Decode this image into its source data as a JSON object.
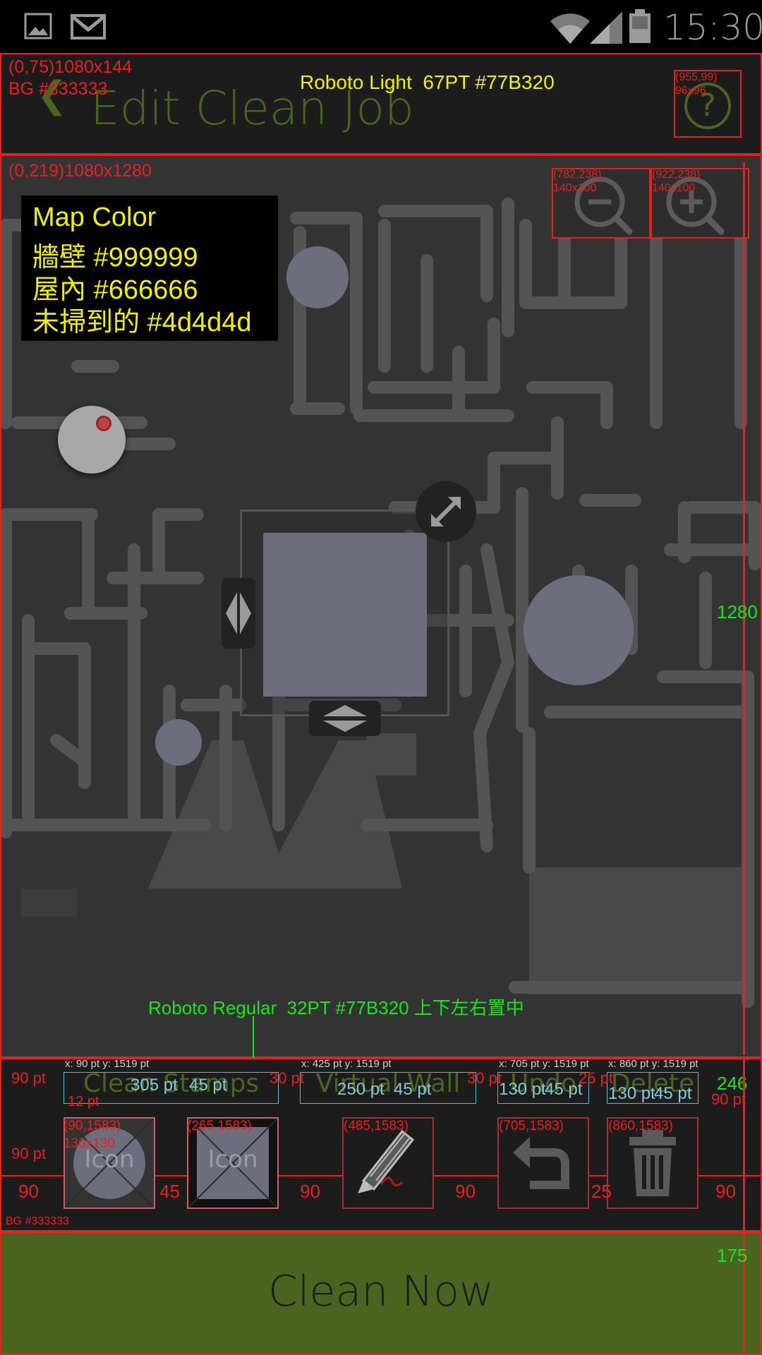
{
  "status_bar": {
    "time": "15:30"
  },
  "header": {
    "back_glyph": "❮",
    "title": "Edit Clean Job",
    "help_glyph": "?",
    "note_geom": "(0,75)1080x144",
    "note_bg": "BG #333333",
    "font_note": "Roboto Light  67PT #77B320",
    "help_note": "(955,99)\n96x96"
  },
  "map": {
    "note_geom": "(0,219)1080x1280",
    "zoom_out_note": "(782,238)\n140x100",
    "zoom_in_note": "(922,238)\n140x100",
    "height_label": "1280",
    "legend": {
      "title": "Map Color",
      "lines": [
        "牆壁 #999999",
        "屋內 #666666",
        "未掃到的 #4d4d4d"
      ]
    },
    "colors": {
      "wall": "#999999",
      "indoor": "#666666",
      "unswept": "#4d4d4d"
    },
    "font_note": "Roboto Regular  32PT #77B320 上下左右置中"
  },
  "toolbar": {
    "labels": [
      {
        "text": "Clean Stamps",
        "coord": "x: 90 pt y: 1519 pt",
        "w": "305 pt",
        "h": "45 pt"
      },
      {
        "text": "Virtual Wall",
        "coord": "x: 425 pt y: 1519 pt",
        "w": "250 pt",
        "h": "45 pt"
      },
      {
        "text": "Undo",
        "coord": "x: 705 pt y: 1519 pt",
        "w": "130 pt",
        "h": "45 pt"
      },
      {
        "text": "Delete",
        "coord": "x: 860 pt y: 1519 pt",
        "w": "130 pt",
        "h": "45 pt"
      }
    ],
    "buttons": [
      {
        "coord": "(90,1583)",
        "size": "130x130",
        "text": "Icon"
      },
      {
        "coord": "(265,1583)",
        "text": "Icon"
      },
      {
        "coord": "(485,1583)"
      },
      {
        "coord": "(705,1583)"
      },
      {
        "coord": "(860,1583)"
      }
    ],
    "annotations": {
      "left_pt": "90 pt",
      "gap1_pt": "30 pt",
      "gap2_pt": "30 pt",
      "gap3_pt": "25 pt",
      "right_pt": "90 pt",
      "top_pt": "12 pt",
      "icon_left_pt": "90 pt",
      "height_label": "246",
      "bg_note": "BG #333333",
      "dims": [
        "90",
        "45",
        "90",
        "90",
        "25",
        "90"
      ]
    }
  },
  "clean_now": {
    "label": "Clean Now",
    "height_label": "175"
  },
  "colors": {
    "accent": "#77B320",
    "header_bg": "#1c1c1c",
    "button_bg": "#496520"
  }
}
